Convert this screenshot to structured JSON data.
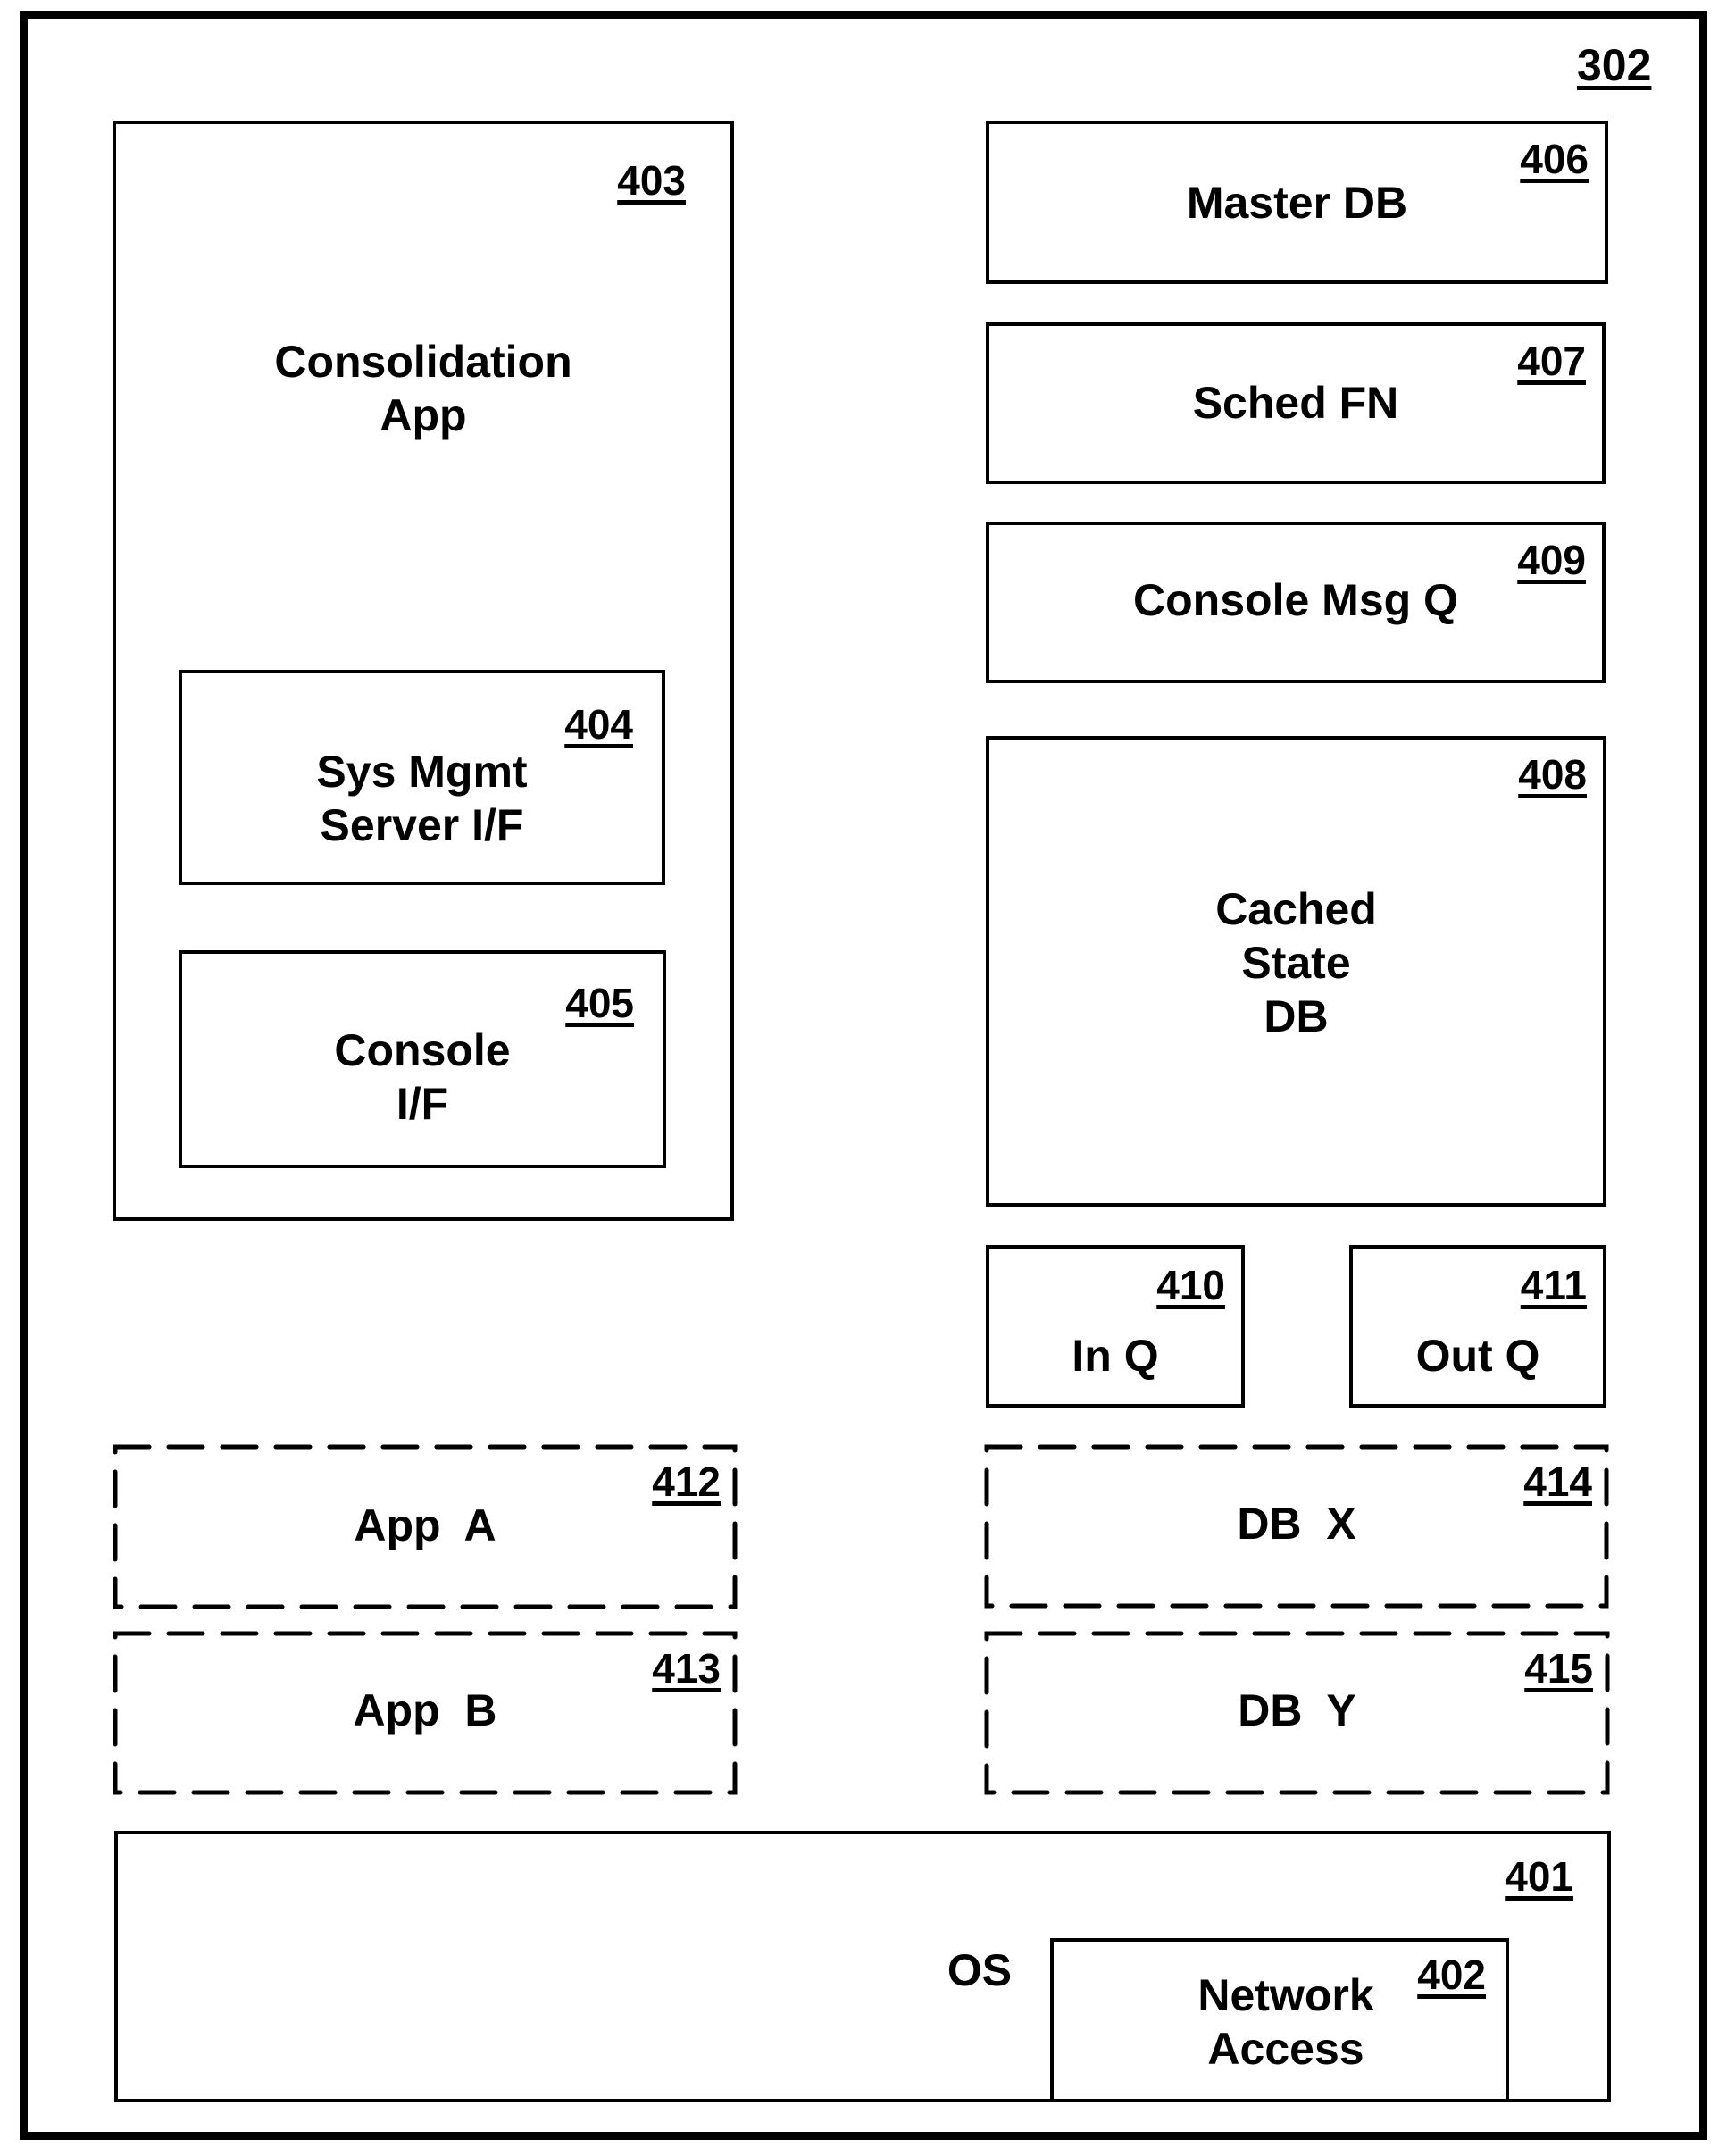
{
  "diagram": {
    "id": "302",
    "components": {
      "consolidation_app": {
        "ref": "403",
        "label_lines": [
          "Consolidation",
          "App"
        ]
      },
      "sys_mgmt_server_if": {
        "ref": "404",
        "label_lines": [
          "Sys Mgmt",
          "Server I/F"
        ]
      },
      "console_if": {
        "ref": "405",
        "label_lines": [
          "Console",
          "I/F"
        ]
      },
      "master_db": {
        "ref": "406",
        "label": "Master DB"
      },
      "sched_fn": {
        "ref": "407",
        "label": "Sched FN"
      },
      "console_msg_q": {
        "ref": "409",
        "label": "Console Msg Q"
      },
      "cached_state_db": {
        "ref": "408",
        "label_lines": [
          "Cached",
          "State",
          "DB"
        ]
      },
      "in_q": {
        "ref": "410",
        "label": "In Q"
      },
      "out_q": {
        "ref": "411",
        "label": "Out Q"
      },
      "app_a": {
        "ref": "412",
        "label": "App  A",
        "style": "dashed"
      },
      "app_b": {
        "ref": "413",
        "label": "App  B",
        "style": "dashed"
      },
      "db_x": {
        "ref": "414",
        "label": "DB  X",
        "style": "dashed"
      },
      "db_y": {
        "ref": "415",
        "label": "DB  Y",
        "style": "dashed"
      },
      "os": {
        "ref": "401",
        "label": "OS"
      },
      "network_access": {
        "ref": "402",
        "label_lines": [
          "Network",
          "Access"
        ]
      }
    }
  }
}
